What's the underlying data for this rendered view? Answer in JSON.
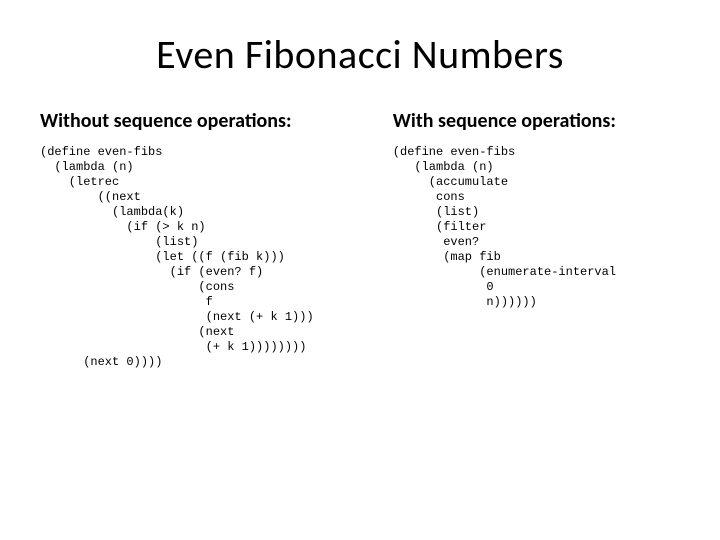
{
  "title": "Even Fibonacci Numbers",
  "left": {
    "header": "Without sequence operations:",
    "code": "(define even-fibs\n  (lambda (n)\n    (letrec\n        ((next\n          (lambda(k)\n            (if (> k n)\n                (list)\n                (let ((f (fib k)))\n                  (if (even? f)\n                      (cons\n                       f\n                       (next (+ k 1)))\n                      (next\n                       (+ k 1))))))))\n      (next 0))))"
  },
  "right": {
    "header": "With sequence operations:",
    "code": "(define even-fibs\n   (lambda (n)\n     (accumulate\n      cons\n      (list)\n      (filter\n       even?\n       (map fib\n            (enumerate-interval\n             0\n             n))))))"
  }
}
